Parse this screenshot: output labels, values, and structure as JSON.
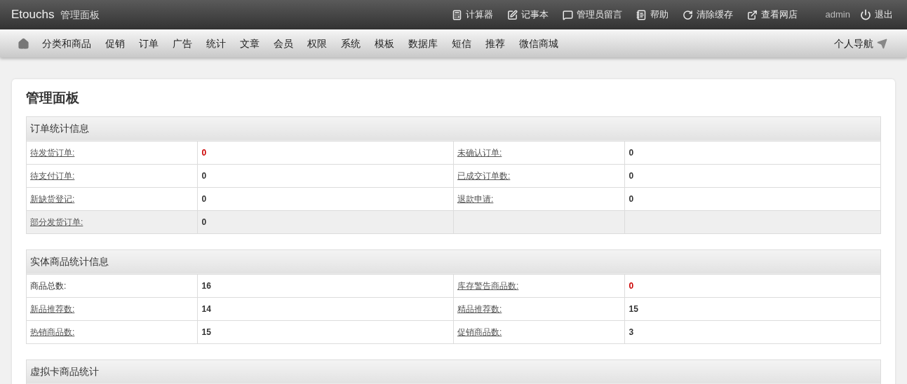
{
  "topbar": {
    "brand": "Etouchs",
    "subtitle": "管理面板",
    "tools": [
      {
        "label": "计算器"
      },
      {
        "label": "记事本"
      },
      {
        "label": "管理员留言"
      },
      {
        "label": "帮助"
      },
      {
        "label": "清除缓存"
      },
      {
        "label": "查看网店"
      }
    ],
    "user": "admin",
    "logout": "退出"
  },
  "nav": {
    "items": [
      "分类和商品",
      "促销",
      "订单",
      "广告",
      "统计",
      "文章",
      "会员",
      "权限",
      "系统",
      "模板",
      "数据库",
      "短信",
      "推荐",
      "微信商城"
    ],
    "personal": "个人导航"
  },
  "page_title": "管理面板",
  "sections": [
    {
      "title": "订单统计信息",
      "rows": [
        {
          "highlighted": false,
          "cells": [
            {
              "label": "待发货订单:",
              "link": true,
              "value": "0",
              "alert": true
            },
            {
              "label": "未确认订单:",
              "link": true,
              "value": "0",
              "alert": false
            }
          ]
        },
        {
          "highlighted": false,
          "cells": [
            {
              "label": "待支付订单:",
              "link": true,
              "value": "0",
              "alert": false
            },
            {
              "label": "已成交订单数:",
              "link": true,
              "value": "0",
              "alert": false
            }
          ]
        },
        {
          "highlighted": false,
          "cells": [
            {
              "label": "新缺货登记:",
              "link": true,
              "value": "0",
              "alert": false
            },
            {
              "label": "退款申请:",
              "link": true,
              "value": "0",
              "alert": false
            }
          ]
        },
        {
          "highlighted": true,
          "cells": [
            {
              "label": "部分发货订单:",
              "link": true,
              "value": "0",
              "alert": false
            }
          ]
        }
      ]
    },
    {
      "title": "实体商品统计信息",
      "rows": [
        {
          "highlighted": false,
          "cells": [
            {
              "label": "商品总数:",
              "link": false,
              "value": "16",
              "alert": false
            },
            {
              "label": "库存警告商品数:",
              "link": true,
              "value": "0",
              "alert": true
            }
          ]
        },
        {
          "highlighted": false,
          "cells": [
            {
              "label": "新品推荐数:",
              "link": true,
              "value": "14",
              "alert": false
            },
            {
              "label": "精品推荐数:",
              "link": true,
              "value": "15",
              "alert": false
            }
          ]
        },
        {
          "highlighted": false,
          "cells": [
            {
              "label": "热销商品数:",
              "link": true,
              "value": "15",
              "alert": false
            },
            {
              "label": "促销商品数:",
              "link": true,
              "value": "3",
              "alert": false
            }
          ]
        }
      ]
    },
    {
      "title": "虚拟卡商品统计"
    }
  ]
}
